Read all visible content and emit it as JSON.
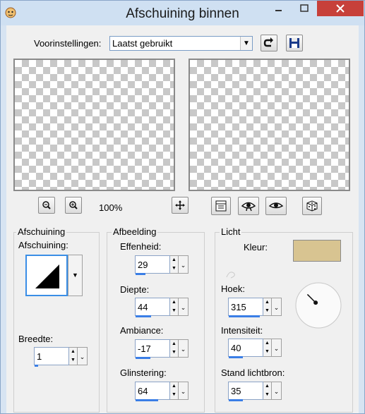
{
  "window": {
    "title": "Afschuining binnen"
  },
  "presets": {
    "label": "Voorinstellingen:",
    "value": "Laatst gebruikt"
  },
  "preview": {
    "zoom": "100%"
  },
  "bevel": {
    "group_title": "Afschuining",
    "shape_label": "Afschuining:",
    "width_label": "Breedte:",
    "width_value": "1",
    "width_fill": 0.1
  },
  "image": {
    "group_title": "Afbeelding",
    "smoothness_label": "Effenheid:",
    "smoothness_value": "29",
    "smoothness_fill": 0.29,
    "depth_label": "Diepte:",
    "depth_value": "44",
    "depth_fill": 0.44,
    "ambience_label": "Ambiance:",
    "ambience_value": "-17",
    "ambience_fill": 0.41,
    "shininess_label": "Glinstering:",
    "shininess_value": "64",
    "shininess_fill": 0.64
  },
  "light": {
    "group_title": "Licht",
    "color_label": "Kleur:",
    "color": "#d8c491",
    "angle_label": "Hoek:",
    "angle_value": "315",
    "angle_fill": 0.88,
    "intensity_label": "Intensiteit:",
    "intensity_value": "40",
    "intensity_fill": 0.4,
    "elevation_label": "Stand lichtbron:",
    "elevation_value": "35",
    "elevation_fill": 0.39
  },
  "colors": {
    "accent": "#3a7ee6",
    "close": "#c7403a"
  }
}
